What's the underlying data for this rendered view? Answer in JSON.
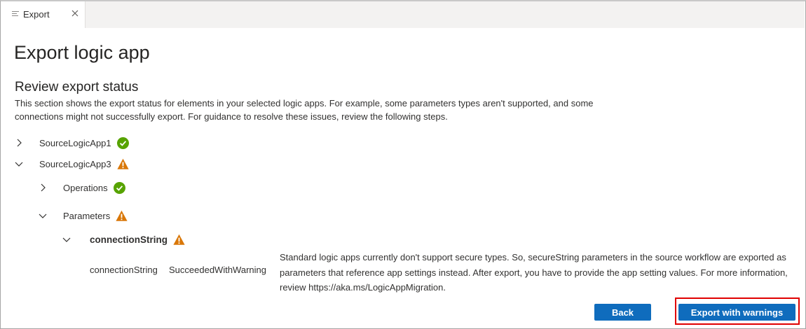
{
  "tab": {
    "label": "Export"
  },
  "page": {
    "title": "Export logic app",
    "section_title": "Review export status",
    "description": "This section shows the export status for elements in your selected logic apps. For example, some parameters types aren't supported, and some connections might not successfully export. For guidance to resolve these issues, review the following steps."
  },
  "tree": {
    "app1": {
      "label": "SourceLogicApp1",
      "status": "success",
      "expanded": false
    },
    "app3": {
      "label": "SourceLogicApp3",
      "status": "warning",
      "expanded": true
    },
    "operations": {
      "label": "Operations",
      "status": "success",
      "expanded": false
    },
    "parameters": {
      "label": "Parameters",
      "status": "warning",
      "expanded": true
    },
    "connection": {
      "label": "connectionString",
      "status": "warning",
      "expanded": true
    }
  },
  "detail": {
    "name": "connectionString",
    "status": "SucceededWithWarning",
    "message": "Standard logic apps currently don't support secure types. So, secureString parameters in the source workflow are exported as parameters that reference app settings instead. After export, you have to provide the app setting values. For more information, review https://aka.ms/LogicAppMigration."
  },
  "buttons": {
    "back": "Back",
    "export": "Export with warnings"
  },
  "colors": {
    "accent": "#0f6cbd",
    "success": "#57a300",
    "warning": "#d97708",
    "highlight": "#e00000"
  }
}
